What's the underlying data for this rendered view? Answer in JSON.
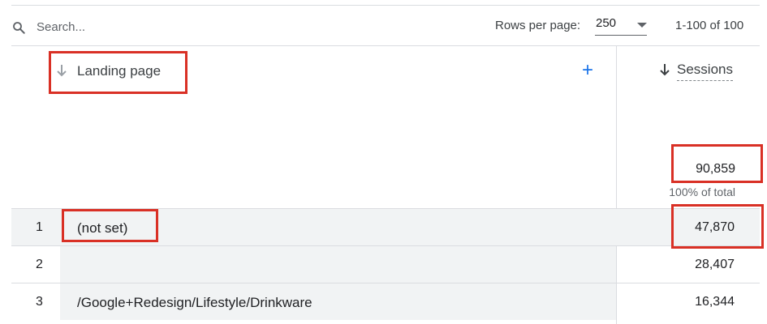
{
  "toolbar": {
    "search_placeholder": "Search...",
    "rows_per_page_label": "Rows per page:",
    "rows_per_page_value": "250",
    "pagination": "1-100 of 100"
  },
  "table": {
    "dimension_header": "Landing page",
    "add_dimension_label": "+",
    "metric_header": "Sessions",
    "total_sessions": "90,859",
    "total_percent": "100% of total",
    "rows": [
      {
        "index": "1",
        "landing_page": "(not set)",
        "sessions": "47,870"
      },
      {
        "index": "2",
        "landing_page": "",
        "sessions": "28,407"
      },
      {
        "index": "3",
        "landing_page": "/Google+Redesign/Lifestyle/Drinkware",
        "sessions": "16,344"
      }
    ]
  },
  "colors": {
    "accent": "#1a73e8",
    "highlight": "#d93025",
    "row_shade": "#f1f3f4",
    "divider": "#dadce0"
  },
  "icons": [
    "search-icon",
    "arrow-down-icon",
    "plus-icon",
    "chevron-down-icon"
  ]
}
